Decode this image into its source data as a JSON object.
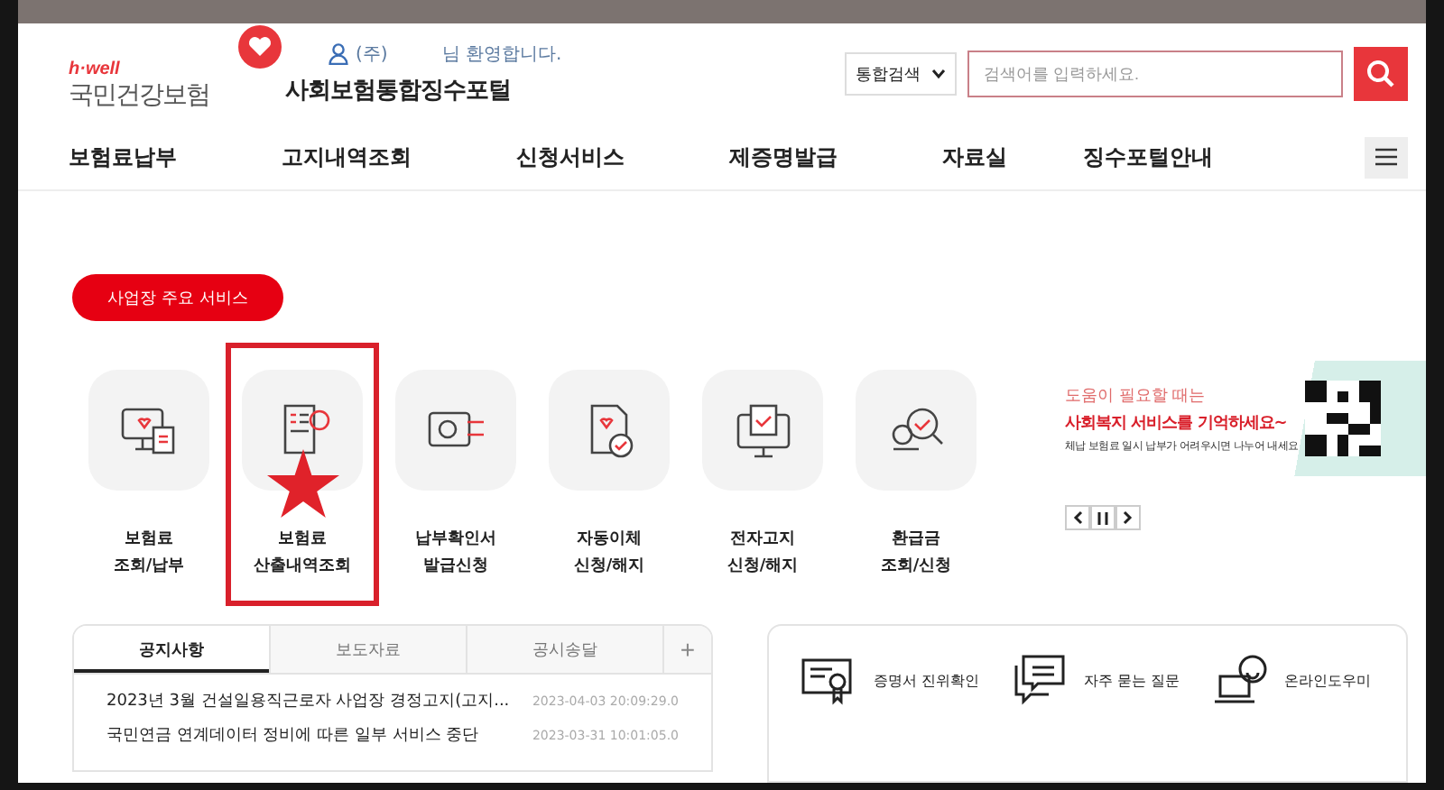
{
  "header": {
    "brand_tag": "h·well",
    "brand_name": "국민건강보험",
    "portal_title": "사회보험통합징수포털",
    "user_company": "(주)",
    "welcome": "님 환영합니다.",
    "search_scope": "통합검색",
    "search_placeholder": "검색어를 입력하세요."
  },
  "nav": [
    "보험료납부",
    "고지내역조회",
    "신청서비스",
    "제증명발급",
    "자료실",
    "징수포털안내"
  ],
  "section_button": "사업장 주요 서비스",
  "services": [
    {
      "kind": "monitor",
      "line1": "보험료",
      "line2": "조회/납부",
      "highlighted": false
    },
    {
      "kind": "scroll",
      "line1": "보험료",
      "line2": "산출내역조회",
      "highlighted": true
    },
    {
      "kind": "card",
      "line1": "납부확인서",
      "line2": "발급신청",
      "highlighted": false
    },
    {
      "kind": "doc",
      "line1": "자동이체",
      "line2": "신청/해지",
      "highlighted": false
    },
    {
      "kind": "screen",
      "line1": "전자고지",
      "line2": "신청/해지",
      "highlighted": false
    },
    {
      "kind": "search",
      "line1": "환급금",
      "line2": "조회/신청",
      "highlighted": false
    }
  ],
  "banner": {
    "line1": "도움이 필요할 때는",
    "line2": "사회복지 서비스를 기억하세요~",
    "line3": "체납 보험료 일시 납부가 어려우시면 나누어 내세요"
  },
  "notices": {
    "tabs": [
      {
        "label": "공지사항",
        "selected": true
      },
      {
        "label": "보도자료",
        "selected": false
      },
      {
        "label": "공시송달",
        "selected": false
      }
    ],
    "more": "+",
    "rows": [
      {
        "title": "2023년 3월 건설일용직근로자 사업장 경정고지(고지...",
        "date": "2023-04-03 20:09:29.0"
      },
      {
        "title": "국민연금 연계데이터 정비에 따른 일부 서비스 중단",
        "date": "2023-03-31 10:01:05.0"
      }
    ]
  },
  "quick_links": [
    {
      "kind": "certificate",
      "label": "증명서 진위확인"
    },
    {
      "kind": "chat",
      "label": "자주 묻는 질문"
    },
    {
      "kind": "bot",
      "label": "온라인도우미"
    }
  ]
}
